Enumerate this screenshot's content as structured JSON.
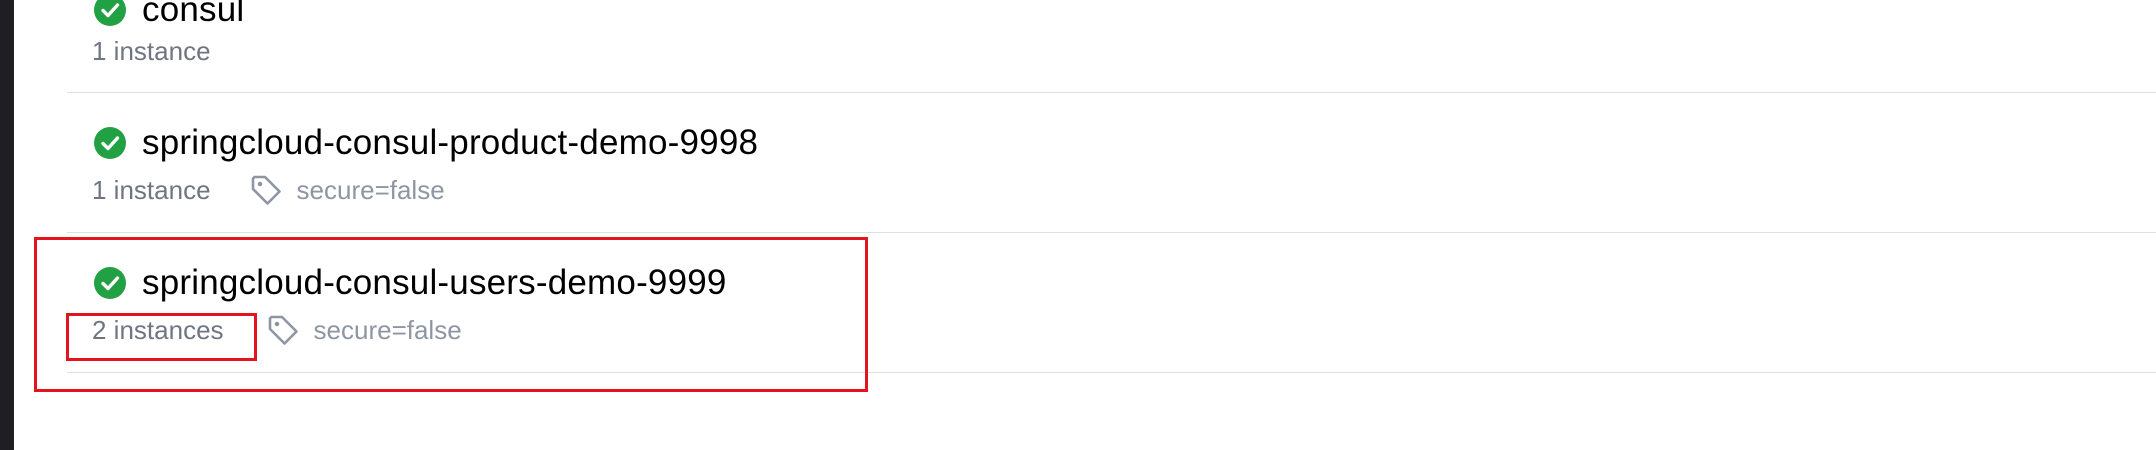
{
  "services": [
    {
      "name": "consul",
      "instances": "1 instance",
      "status": "passing",
      "tags": []
    },
    {
      "name": "springcloud-consul-product-demo-9998",
      "instances": "1 instance",
      "status": "passing",
      "tags": [
        "secure=false"
      ]
    },
    {
      "name": "springcloud-consul-users-demo-9999",
      "instances": "2 instances",
      "status": "passing",
      "tags": [
        "secure=false"
      ]
    }
  ],
  "colors": {
    "status_passing": "#21a044",
    "highlight": "#e3141d",
    "divider": "#dedfe3",
    "meta_text": "#6f7682",
    "tag_text": "#8e96a3"
  },
  "icons": {
    "status": "check-circle-icon",
    "tag": "tag-icon"
  }
}
